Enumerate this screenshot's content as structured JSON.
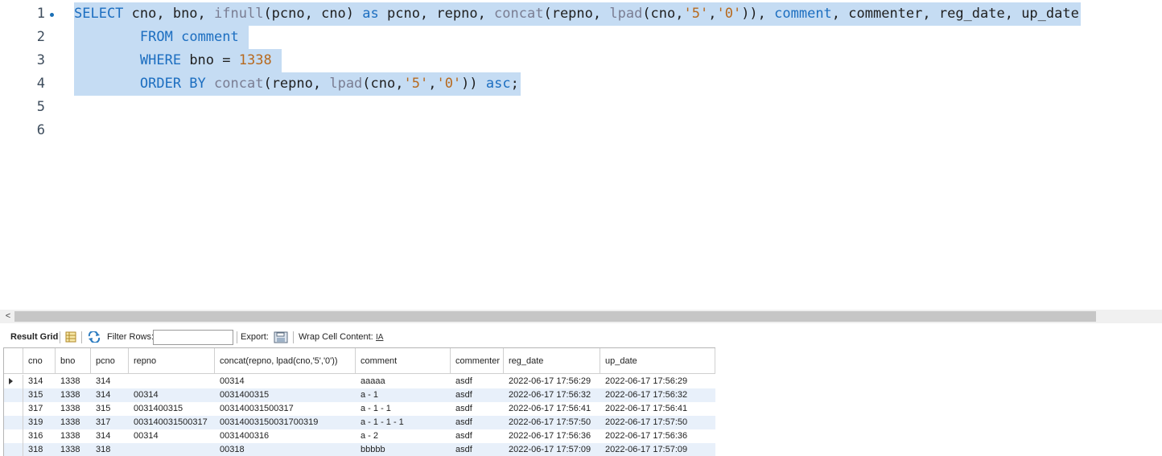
{
  "editor": {
    "lines": [
      {
        "no": "1"
      },
      {
        "no": "2"
      },
      {
        "no": "3"
      },
      {
        "no": "4"
      },
      {
        "no": "5"
      },
      {
        "no": "6"
      }
    ],
    "sql": {
      "l1": {
        "t1": "SELECT",
        "t2": " cno, bno, ",
        "t3": "ifnull",
        "t4": "(pcno, cno) ",
        "t5": "as",
        "t6": " pcno, repno, ",
        "t7": "concat",
        "t8": "(repno, ",
        "t9": "lpad",
        "t10": "(cno,",
        "t11": "'5'",
        "t12": ",",
        "t13": "'0'",
        "t14": ")), ",
        "t15": "comment",
        "t16": ", commenter, reg_date, up_date"
      },
      "l2": {
        "t1": "FROM",
        "t2": " ",
        "t3": "comment"
      },
      "l3": {
        "t1": "WHERE",
        "t2": " bno = ",
        "t3": "1338"
      },
      "l4": {
        "t1": "ORDER BY",
        "t2": " ",
        "t3": "concat",
        "t4": "(repno, ",
        "t5": "lpad",
        "t6": "(cno,",
        "t7": "'5'",
        "t8": ",",
        "t9": "'0'",
        "t10": ")) ",
        "t11": "asc",
        "t12": ";"
      }
    }
  },
  "scrollbar": {
    "left_arrow": "<"
  },
  "toolbar": {
    "result_grid_label": "Result Grid",
    "filter_rows_label": "Filter Rows:",
    "filter_value": "",
    "export_label": "Export:",
    "wrap_label": "Wrap Cell Content:",
    "wrap_icon_glyph": "IA"
  },
  "grid": {
    "columns": [
      {
        "label": "cno"
      },
      {
        "label": "bno"
      },
      {
        "label": "pcno"
      },
      {
        "label": "repno"
      },
      {
        "label": "concat(repno, lpad(cno,'5','0'))"
      },
      {
        "label": "comment"
      },
      {
        "label": "commenter"
      },
      {
        "label": "reg_date"
      },
      {
        "label": "up_date"
      }
    ],
    "rows": [
      [
        "314",
        "1338",
        "314",
        "",
        "00314",
        "aaaaa",
        "asdf",
        "2022-06-17 17:56:29",
        "2022-06-17 17:56:29"
      ],
      [
        "315",
        "1338",
        "314",
        "00314",
        "0031400315",
        "a - 1",
        "asdf",
        "2022-06-17 17:56:32",
        "2022-06-17 17:56:32"
      ],
      [
        "317",
        "1338",
        "315",
        "0031400315",
        "003140031500317",
        "a - 1 - 1",
        "asdf",
        "2022-06-17 17:56:41",
        "2022-06-17 17:56:41"
      ],
      [
        "319",
        "1338",
        "317",
        "003140031500317",
        "00314003150031700319",
        "a - 1 - 1 - 1",
        "asdf",
        "2022-06-17 17:57:50",
        "2022-06-17 17:57:50"
      ],
      [
        "316",
        "1338",
        "314",
        "00314",
        "0031400316",
        "a - 2",
        "asdf",
        "2022-06-17 17:56:36",
        "2022-06-17 17:56:36"
      ],
      [
        "318",
        "1338",
        "318",
        "",
        "00318",
        "bbbbb",
        "asdf",
        "2022-06-17 17:57:09",
        "2022-06-17 17:57:09"
      ]
    ]
  },
  "colors": {
    "keyword": "#1c6ec0",
    "function": "#7a7d92",
    "string": "#b7691e",
    "selection": "#c5dcf3",
    "alt_row": "#e8f0fa"
  }
}
